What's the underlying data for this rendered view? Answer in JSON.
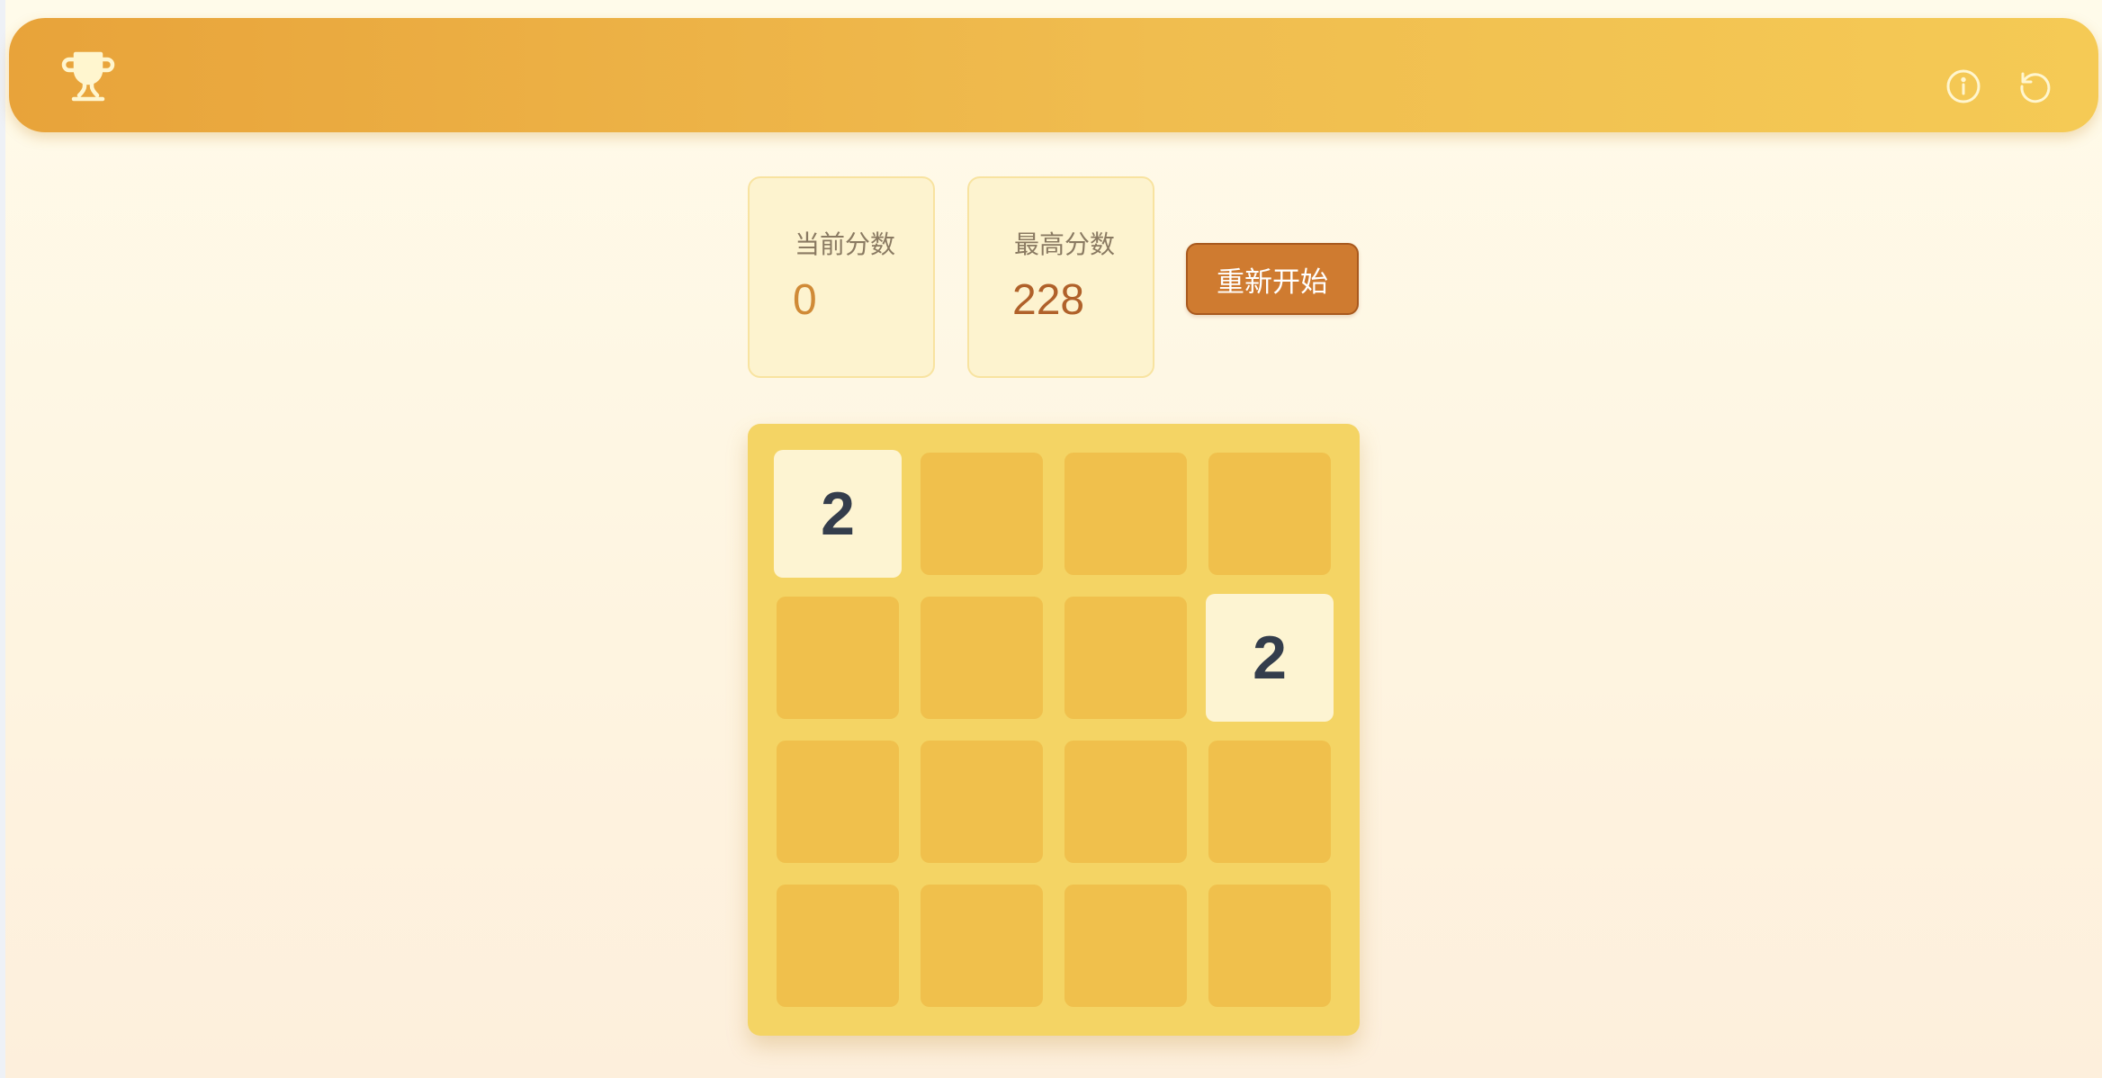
{
  "header": {
    "logo_icon": "trophy-icon",
    "actions": [
      {
        "name": "info",
        "icon": "info-circle-icon"
      },
      {
        "name": "reset",
        "icon": "rotate-ccw-icon"
      }
    ],
    "colors": {
      "gradient_start": "#e8a33a",
      "gradient_end": "#f5ca55",
      "icon": "#fff6cf"
    }
  },
  "scores": {
    "current": {
      "label": "当前分数",
      "value": "0"
    },
    "best": {
      "label": "最高分数",
      "value": "228"
    }
  },
  "restart_button": {
    "label": "重新开始",
    "color": "#cf7b30"
  },
  "board": {
    "size": 4,
    "grid": [
      [
        2,
        null,
        null,
        null
      ],
      [
        null,
        null,
        null,
        2
      ],
      [
        null,
        null,
        null,
        null
      ],
      [
        null,
        null,
        null,
        null
      ]
    ],
    "colors": {
      "board": "#f4d464",
      "empty_cell": "#f0c04c",
      "tile_2": "#fdf4d2",
      "tile_text": "#343d4c"
    }
  }
}
